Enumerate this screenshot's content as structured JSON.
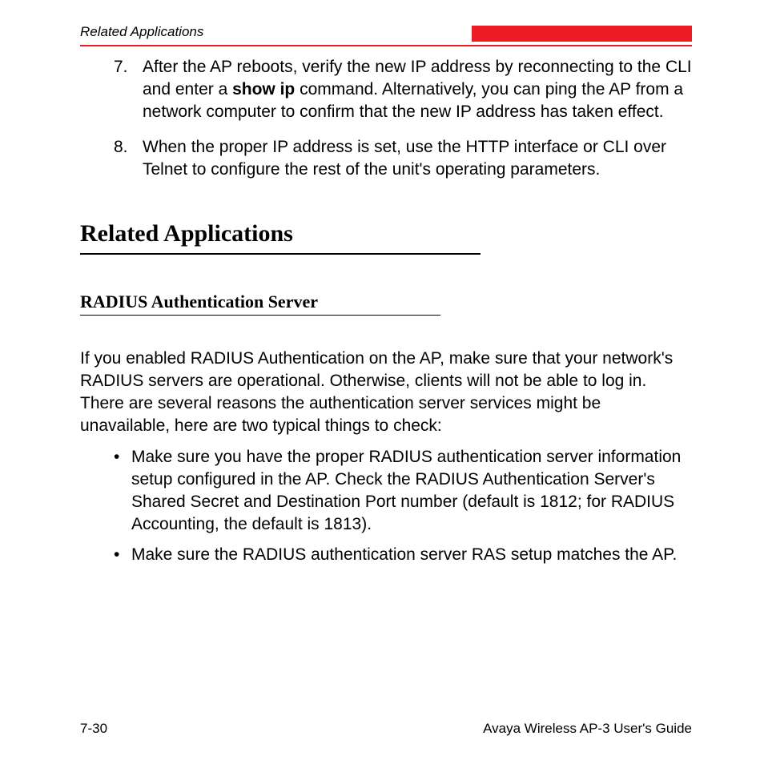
{
  "header": {
    "section": "Related Applications"
  },
  "numbered": [
    {
      "num": "7.",
      "pre": "After the AP reboots, verify the new IP address by reconnecting to the CLI and enter a ",
      "bold": "show ip",
      "post": " command. Alternatively, you can ping the AP from a network computer to confirm that the new IP address has taken effect."
    },
    {
      "num": "8.",
      "pre": "When the proper IP address is set, use the HTTP interface or CLI over Telnet to configure the rest of the unit's operating parameters.",
      "bold": "",
      "post": ""
    }
  ],
  "h1": "Related Applications",
  "h2": "RADIUS Authentication Server",
  "paragraph": "If you enabled RADIUS Authentication on the AP, make sure that your network's RADIUS servers are operational. Otherwise, clients will not be able to log in. There are several reasons the authentication server services might be unavailable, here are two typical things to check:",
  "bullets": [
    "Make sure you have the proper RADIUS authentication server information setup configured in the AP. Check the RADIUS Authentication Server's Shared Secret and Destination Port number (default is 1812; for RADIUS Accounting, the default is 1813).",
    "Make sure the RADIUS authentication server RAS setup matches the AP."
  ],
  "footer": {
    "left": "7-30",
    "right": "Avaya Wireless AP-3 User's Guide"
  }
}
